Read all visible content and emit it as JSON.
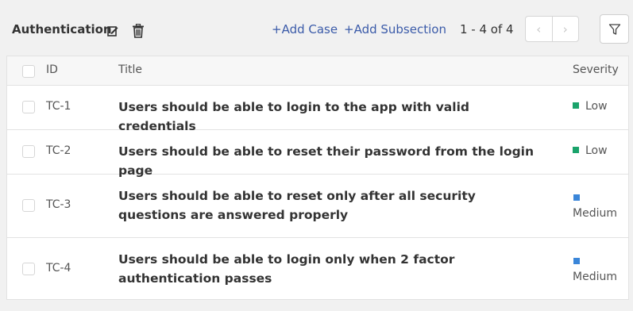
{
  "section": {
    "title": "Authentication"
  },
  "actions": {
    "add_case": "+Add Case",
    "add_subsection": "+Add Subsection"
  },
  "pagination": {
    "text": "1 - 4 of 4",
    "prev": "‹",
    "next": "›"
  },
  "table": {
    "headers": {
      "id": "ID",
      "title": "Title",
      "severity": "Severity"
    },
    "rows": [
      {
        "id": "TC-1",
        "title": "Users should be able to login to the app with valid credentials",
        "severity": "Low"
      },
      {
        "id": "TC-2",
        "title": "Users should be able to reset their password from the login page",
        "severity": "Low"
      },
      {
        "id": "TC-3",
        "title": "Users should be able to reset only after all security questions are answered properly",
        "severity": "Medium"
      },
      {
        "id": "TC-4",
        "title": "Users should be able to login only when 2 factor authentication passes",
        "severity": "Medium"
      }
    ]
  },
  "colors": {
    "low": "#1aa36b",
    "medium": "#3a86d9",
    "link": "#3b5ba9"
  }
}
